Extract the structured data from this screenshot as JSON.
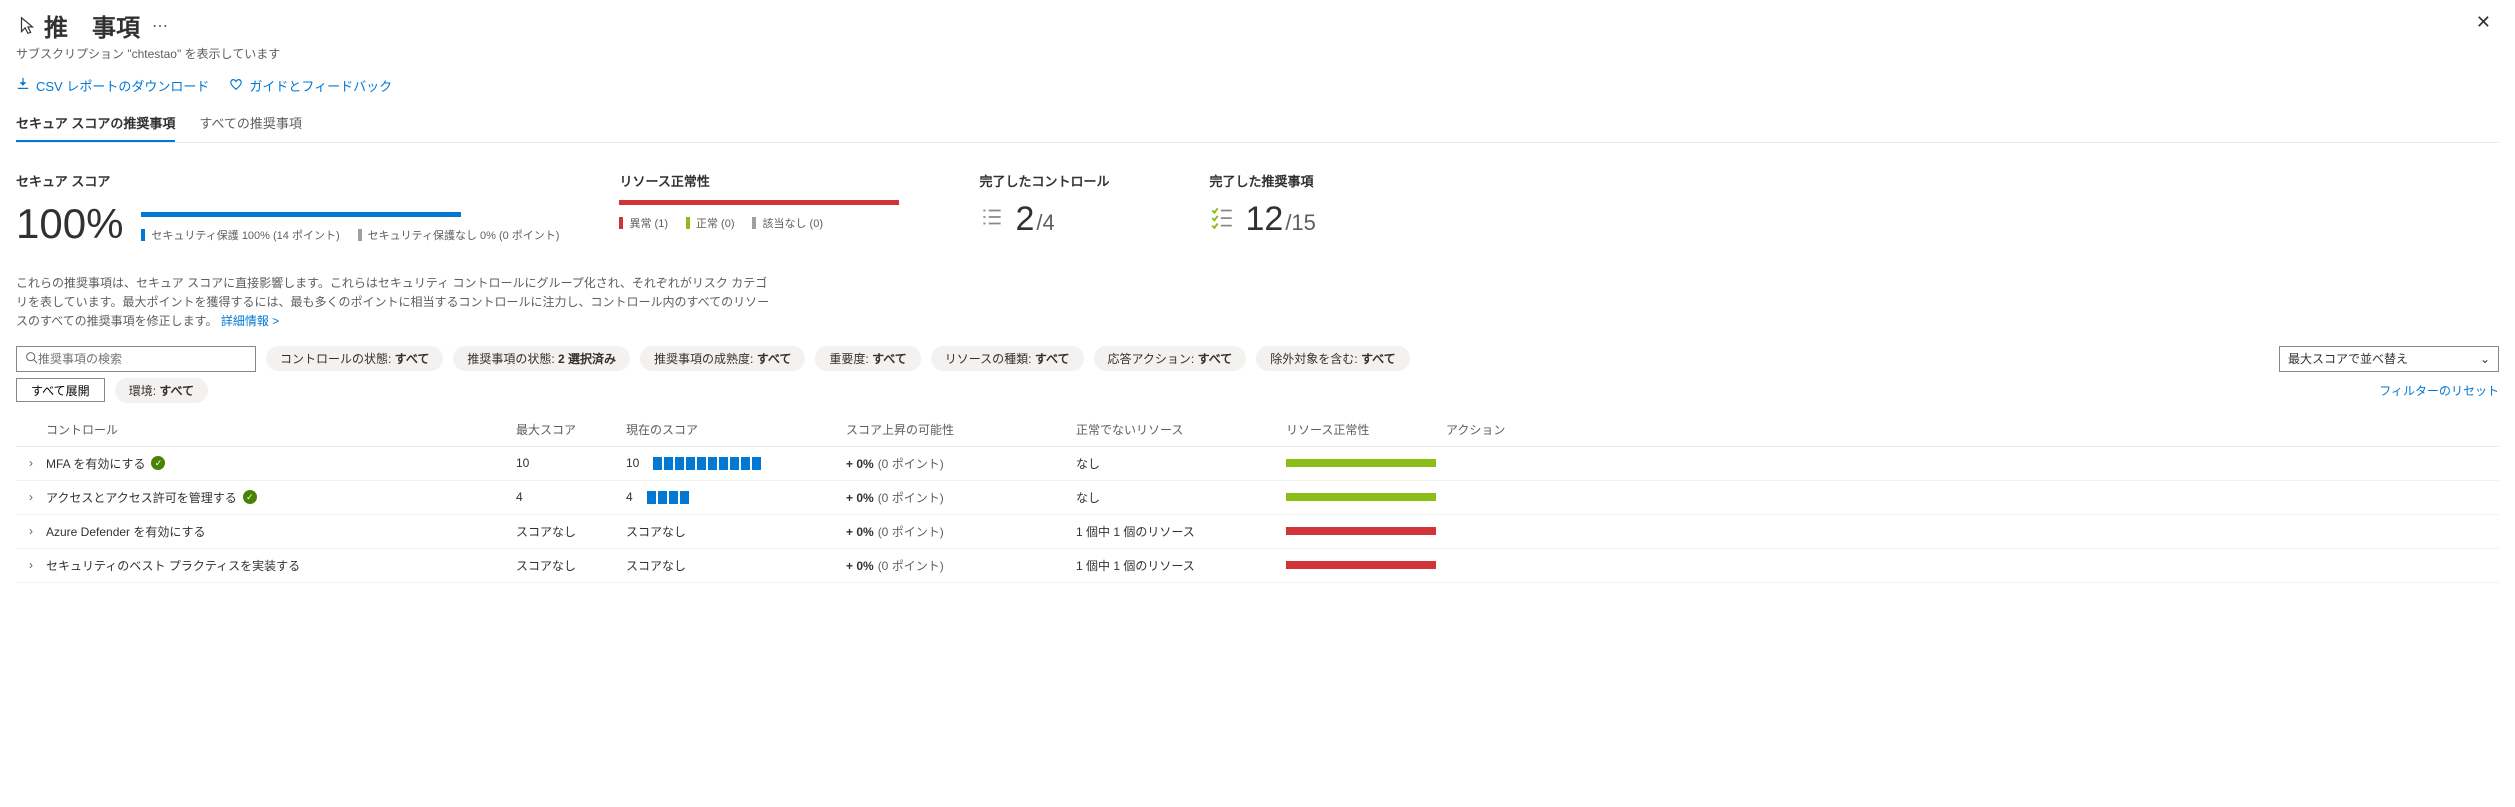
{
  "header": {
    "title_visible": "推　事項",
    "subtitle": "サブスクリプション \"chtestao\" を表示しています"
  },
  "toolbar": {
    "csv": "CSV レポートのダウンロード",
    "feedback": "ガイドとフィードバック"
  },
  "tabs": {
    "secure": "セキュア スコアの推奨事項",
    "all": "すべての推奨事項"
  },
  "kpi": {
    "score_label": "セキュア スコア",
    "score_value": "100%",
    "score_protected": "セキュリティ保護 100% (14 ポイント)",
    "score_unprotected": "セキュリティ保護なし 0% (0 ポイント)",
    "health_label": "リソース正常性",
    "health_abnormal": "異常 (1)",
    "health_normal": "正常 (0)",
    "health_na": "該当なし (0)",
    "controls_label": "完了したコントロール",
    "controls_num": "2",
    "controls_den": "/4",
    "recs_label": "完了した推奨事項",
    "recs_num": "12",
    "recs_den": "/15"
  },
  "description": {
    "text": "これらの推奨事項は、セキュア スコアに直接影響します。これらはセキュリティ コントロールにグループ化され、それぞれがリスク カテゴリを表しています。最大ポイントを獲得するには、最も多くのポイントに相当するコントロールに注力し、コントロール内のすべてのリソースのすべての推奨事項を修正します。",
    "link": "詳細情報 >"
  },
  "filters": {
    "search_placeholder": "推奨事項の検索",
    "control_status": "コントロールの状態: ",
    "control_status_val": "すべて",
    "rec_status": "推奨事項の状態: ",
    "rec_status_val": "2 選択済み",
    "maturity": "推奨事項の成熟度: ",
    "maturity_val": "すべて",
    "severity": "重要度: ",
    "severity_val": "すべて",
    "resource_type": "リソースの種類: ",
    "resource_type_val": "すべて",
    "response": "応答アクション: ",
    "response_val": "すべて",
    "exempt": "除外対象を含む: ",
    "exempt_val": "すべて",
    "env": "環境: ",
    "env_val": "すべて",
    "sort": "最大スコアで並べ替え",
    "expand_all": "すべて展開",
    "reset": "フィルターのリセット"
  },
  "columns": {
    "control": "コントロール",
    "max": "最大スコア",
    "current": "現在のスコア",
    "potential": "スコア上昇の可能性",
    "unhealthy": "正常でないリソース",
    "health": "リソース正常性",
    "actions": "アクション"
  },
  "rows": [
    {
      "name": "MFA を有効にする",
      "ok": true,
      "max": "10",
      "cur": "10",
      "segs": 10,
      "pct": "+ 0%",
      "pct_sub": "(0 ポイント)",
      "unhealthy": "なし",
      "bar": "green"
    },
    {
      "name": "アクセスとアクセス許可を管理する",
      "ok": true,
      "max": "4",
      "cur": "4",
      "segs": 4,
      "pct": "+ 0%",
      "pct_sub": "(0 ポイント)",
      "unhealthy": "なし",
      "bar": "green"
    },
    {
      "name": "Azure Defender を有効にする",
      "ok": false,
      "max": "スコアなし",
      "cur": "スコアなし",
      "segs": 0,
      "pct": "+ 0%",
      "pct_sub": "(0 ポイント)",
      "unhealthy": "1 個中 1 個のリソース",
      "bar": "red"
    },
    {
      "name": "セキュリティのベスト プラクティスを実装する",
      "ok": false,
      "max": "スコアなし",
      "cur": "スコアなし",
      "segs": 0,
      "pct": "+ 0%",
      "pct_sub": "(0 ポイント)",
      "unhealthy": "1 個中 1 個のリソース",
      "bar": "red"
    }
  ]
}
